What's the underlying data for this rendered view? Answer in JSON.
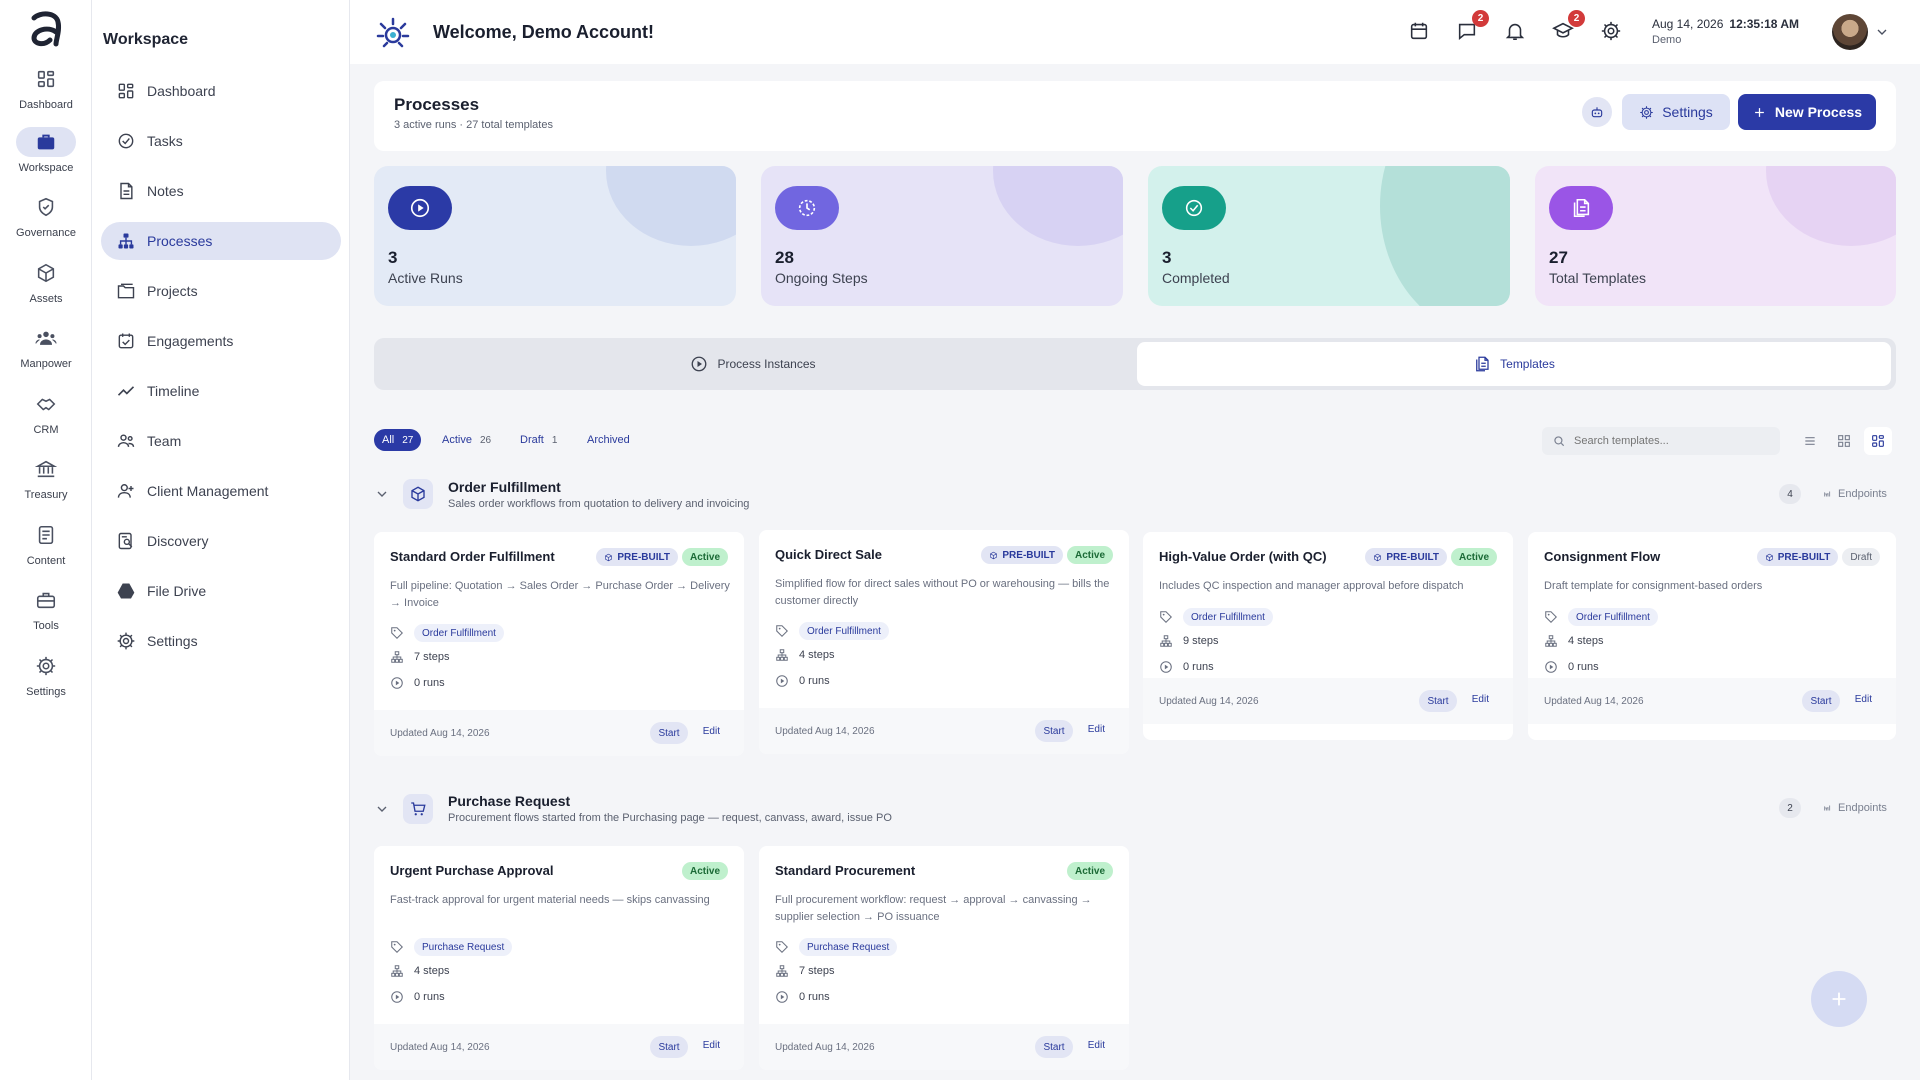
{
  "rail": {
    "items": [
      {
        "label": "Dashboard",
        "icon": "grid-icon"
      },
      {
        "label": "Workspace",
        "icon": "briefcase-icon"
      },
      {
        "label": "Governance",
        "icon": "shield-icon"
      },
      {
        "label": "Assets",
        "icon": "cube-icon"
      },
      {
        "label": "Manpower",
        "icon": "people-icon"
      },
      {
        "label": "CRM",
        "icon": "handshake-icon"
      },
      {
        "label": "Treasury",
        "icon": "bank-icon"
      },
      {
        "label": "Content",
        "icon": "document-icon"
      },
      {
        "label": "Tools",
        "icon": "toolbox-icon"
      },
      {
        "label": "Settings",
        "icon": "gear-icon"
      }
    ]
  },
  "sidebar": {
    "title": "Workspace",
    "items": [
      {
        "label": "Dashboard"
      },
      {
        "label": "Tasks"
      },
      {
        "label": "Notes"
      },
      {
        "label": "Processes"
      },
      {
        "label": "Projects"
      },
      {
        "label": "Engagements"
      },
      {
        "label": "Timeline"
      },
      {
        "label": "Team"
      },
      {
        "label": "Client Management"
      },
      {
        "label": "Discovery"
      },
      {
        "label": "File Drive"
      },
      {
        "label": "Settings"
      }
    ]
  },
  "topbar": {
    "title": "Welcome, Demo Account!",
    "chat_badge": "2",
    "learn_badge": "2",
    "date": "Aug 14, 2026",
    "time": "12:35:18 AM",
    "user": "Demo"
  },
  "header": {
    "title": "Processes",
    "subtitle": "3 active runs · 27 total templates",
    "settings_label": "Settings",
    "new_label": "New Process"
  },
  "stats": [
    {
      "value": "3",
      "label": "Active Runs",
      "color": "#2b3aa6"
    },
    {
      "value": "28",
      "label": "Ongoing Steps",
      "color": "#7166e0"
    },
    {
      "value": "3",
      "label": "Completed",
      "color": "#16a08a"
    },
    {
      "value": "27",
      "label": "Total Templates",
      "color": "#9a55e6"
    }
  ],
  "tabs": [
    {
      "label": "Process Instances"
    },
    {
      "label": "Templates"
    }
  ],
  "filters": [
    {
      "label": "All",
      "count": "27"
    },
    {
      "label": "Active",
      "count": "26"
    },
    {
      "label": "Draft",
      "count": "1"
    },
    {
      "label": "Archived",
      "count": ""
    }
  ],
  "search": {
    "placeholder": "Search templates..."
  },
  "groups": [
    {
      "title": "Order Fulfillment",
      "subtitle": "Sales order workflows from quotation to delivery and invoicing",
      "count": "4",
      "endpoints_label": "Endpoints",
      "cards": [
        {
          "title": "Standard Order Fulfillment",
          "prebuilt": "PRE-BUILT",
          "status": "Active",
          "desc": "Full pipeline: Quotation → Sales Order → Purchase Order → Delivery → Invoice",
          "tag": "Order Fulfillment",
          "steps": "7 steps",
          "runs": "0 runs",
          "updated": "Updated Aug 14, 2026",
          "start": "Start",
          "edit": "Edit"
        },
        {
          "title": "Quick Direct Sale",
          "prebuilt": "PRE-BUILT",
          "status": "Active",
          "desc": "Simplified flow for direct sales without PO or warehousing — bills the customer directly",
          "tag": "Order Fulfillment",
          "steps": "4 steps",
          "runs": "0 runs",
          "updated": "Updated Aug 14, 2026",
          "start": "Start",
          "edit": "Edit"
        },
        {
          "title": "High-Value Order (with QC)",
          "prebuilt": "PRE-BUILT",
          "status": "Active",
          "desc": "Includes QC inspection and manager approval before dispatch",
          "tag": "Order Fulfillment",
          "steps": "9 steps",
          "runs": "0 runs",
          "updated": "Updated Aug 14, 2026",
          "start": "Start",
          "edit": "Edit"
        },
        {
          "title": "Consignment Flow",
          "prebuilt": "PRE-BUILT",
          "status": "Draft",
          "desc": "Draft template for consignment-based orders",
          "tag": "Order Fulfillment",
          "steps": "4 steps",
          "runs": "0 runs",
          "updated": "Updated Aug 14, 2026",
          "start": "Start",
          "edit": "Edit"
        }
      ]
    },
    {
      "title": "Purchase Request",
      "subtitle": "Procurement flows started from the Purchasing page — request, canvass, award, issue PO",
      "count": "2",
      "endpoints_label": "Endpoints",
      "cards": [
        {
          "title": "Urgent Purchase Approval",
          "status": "Active",
          "desc": "Fast-track approval for urgent material needs — skips canvassing",
          "tag": "Purchase Request",
          "steps": "4 steps",
          "runs": "0 runs",
          "updated": "Updated Aug 14, 2026",
          "start": "Start",
          "edit": "Edit"
        },
        {
          "title": "Standard Procurement",
          "status": "Active",
          "desc": "Full procurement workflow: request → approval → canvassing → supplier selection → PO issuance",
          "tag": "Purchase Request",
          "steps": "7 steps",
          "runs": "0 runs",
          "updated": "Updated Aug 14, 2026",
          "start": "Start",
          "edit": "Edit"
        }
      ]
    }
  ]
}
